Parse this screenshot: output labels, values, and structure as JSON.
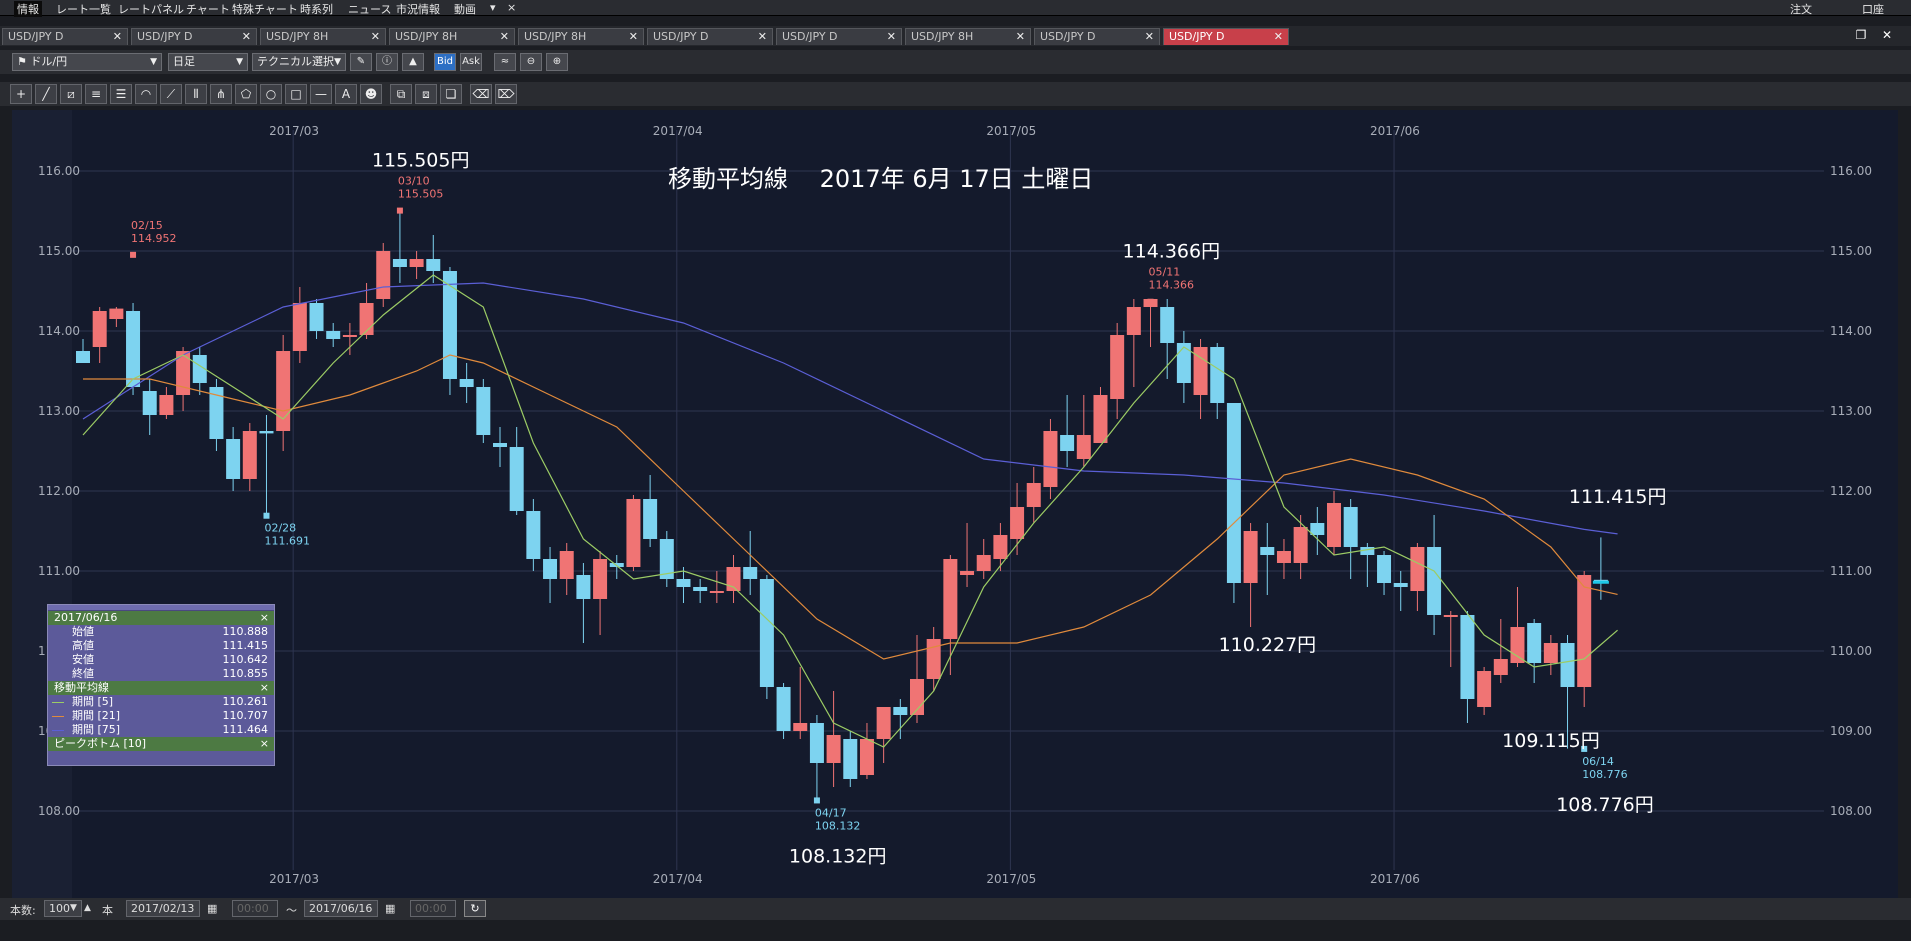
{
  "menu": {
    "items": [
      "情報",
      "レート一覧",
      "レートパネル",
      "チャート",
      "特殊チャート",
      "時系列",
      "ニュース",
      "市況情報",
      "動画"
    ],
    "dropdown_glyph": "▾",
    "close_glyph": "×",
    "right_items": [
      "注文",
      "口座"
    ]
  },
  "tabs": [
    {
      "label": "USD/JPY D",
      "active": false
    },
    {
      "label": "USD/JPY D",
      "active": false
    },
    {
      "label": "USD/JPY 8H",
      "active": false
    },
    {
      "label": "USD/JPY 8H",
      "active": false
    },
    {
      "label": "USD/JPY 8H",
      "active": false
    },
    {
      "label": "USD/JPY D",
      "active": false
    },
    {
      "label": "USD/JPY D",
      "active": false
    },
    {
      "label": "USD/JPY 8H",
      "active": false
    },
    {
      "label": "USD/JPY D",
      "active": false
    },
    {
      "label": "USD/JPY D",
      "active": true
    }
  ],
  "toolbar": {
    "pair": "ドル/円",
    "timeframe": "日足",
    "technical": "テクニカル選択",
    "bid": "Bid",
    "ask": "Ask"
  },
  "bottom": {
    "count_label": "本数:",
    "count_value": "100",
    "count_unit": "本",
    "from_date": "2017/02/13",
    "to_date": "2017/06/16",
    "from_time": "00:00",
    "to_time": "00:00",
    "tilde": "～"
  },
  "legend": {
    "date": "2017/06/16",
    "rows": [
      {
        "label": "始値",
        "value": "110.888"
      },
      {
        "label": "高値",
        "value": "111.415"
      },
      {
        "label": "安値",
        "value": "110.642"
      },
      {
        "label": "終値",
        "value": "110.855"
      }
    ],
    "ma_header": "移動平均線",
    "ma_rows": [
      {
        "label": "期間 [5]",
        "value": "110.261",
        "color": "#9ccc65"
      },
      {
        "label": "期間 [21]",
        "value": "110.707",
        "color": "#e08a3c"
      },
      {
        "label": "期間 [75]",
        "value": "111.464",
        "color": "#5b5fd6"
      }
    ],
    "peak_header": "ピークボトム [10]",
    "close_glyph": "×"
  },
  "chart_data": {
    "type": "candlestick",
    "title": "移動平均線　 2017年 6月 17日 土曜日",
    "ylim": [
      107.3,
      116.8
    ],
    "yticks": [
      "116.00",
      "115.00",
      "114.00",
      "113.00",
      "112.00",
      "111.00",
      "110.00",
      "109.00",
      "108.00"
    ],
    "ytick_values": [
      116,
      115,
      114,
      113,
      112,
      111,
      110,
      109,
      108
    ],
    "xticks": [
      {
        "label": "2017/03",
        "index": 12
      },
      {
        "label": "2017/04",
        "index": 35
      },
      {
        "label": "2017/05",
        "index": 55
      },
      {
        "label": "2017/06",
        "index": 78
      }
    ],
    "colors": {
      "up": "#f07474",
      "down": "#7dd3f0",
      "ma5": "#9ccc65",
      "ma21": "#e08a3c",
      "ma75": "#5b5fd6",
      "grid": "#2e3550",
      "axis_text": "#a8adb8"
    },
    "candles": [
      [
        113.75,
        113.6,
        113.9,
        113.6
      ],
      [
        113.8,
        114.25,
        113.6,
        114.3
      ],
      [
        114.15,
        114.28,
        114.3,
        114.05
      ],
      [
        114.25,
        113.3,
        114.35,
        113.2
      ],
      [
        113.25,
        112.95,
        113.4,
        112.7
      ],
      [
        112.95,
        113.2,
        113.3,
        112.9
      ],
      [
        113.2,
        113.75,
        113.8,
        113.0
      ],
      [
        113.7,
        113.35,
        113.8,
        113.2
      ],
      [
        113.3,
        112.65,
        113.4,
        112.5
      ],
      [
        112.65,
        112.15,
        112.8,
        112.0
      ],
      [
        112.15,
        112.75,
        112.85,
        112.0
      ],
      [
        112.75,
        112.72,
        112.95,
        111.69
      ],
      [
        112.75,
        113.75,
        113.95,
        112.5
      ],
      [
        113.75,
        114.35,
        114.55,
        113.6
      ],
      [
        114.35,
        114.0,
        114.4,
        113.9
      ],
      [
        114.0,
        113.9,
        114.1,
        113.8
      ],
      [
        113.95,
        113.95,
        114.1,
        113.7
      ],
      [
        113.95,
        114.35,
        114.6,
        113.9
      ],
      [
        114.4,
        115.0,
        115.1,
        114.3
      ],
      [
        114.9,
        114.8,
        115.5,
        114.6
      ],
      [
        114.8,
        114.9,
        115.0,
        114.65
      ],
      [
        114.9,
        114.75,
        115.2,
        114.6
      ],
      [
        114.75,
        113.4,
        114.8,
        113.2
      ],
      [
        113.4,
        113.3,
        113.6,
        113.1
      ],
      [
        113.3,
        112.7,
        113.4,
        112.6
      ],
      [
        112.6,
        112.55,
        112.8,
        112.3
      ],
      [
        112.55,
        111.75,
        112.8,
        111.7
      ],
      [
        111.75,
        111.15,
        111.9,
        111.0
      ],
      [
        111.15,
        110.9,
        111.3,
        110.6
      ],
      [
        110.9,
        111.25,
        111.35,
        110.7
      ],
      [
        110.95,
        110.65,
        111.1,
        110.1
      ],
      [
        110.65,
        111.15,
        111.25,
        110.2
      ],
      [
        111.1,
        111.05,
        111.2,
        110.9
      ],
      [
        111.05,
        111.9,
        111.95,
        111.0
      ],
      [
        111.9,
        111.4,
        112.2,
        111.3
      ],
      [
        111.4,
        110.9,
        111.5,
        110.8
      ],
      [
        110.9,
        110.8,
        111.05,
        110.6
      ],
      [
        110.8,
        110.75,
        110.9,
        110.6
      ],
      [
        110.75,
        110.75,
        111.0,
        110.6
      ],
      [
        110.75,
        111.05,
        111.2,
        110.6
      ],
      [
        111.05,
        110.9,
        111.5,
        110.7
      ],
      [
        110.9,
        109.55,
        110.95,
        109.4
      ],
      [
        109.55,
        109.0,
        109.6,
        108.9
      ],
      [
        109.0,
        109.1,
        109.8,
        108.9
      ],
      [
        109.1,
        108.6,
        109.2,
        108.13
      ],
      [
        108.6,
        108.95,
        109.5,
        108.3
      ],
      [
        108.9,
        108.4,
        109.0,
        108.3
      ],
      [
        108.45,
        108.9,
        109.1,
        108.4
      ],
      [
        108.9,
        109.3,
        109.3,
        108.6
      ],
      [
        109.3,
        109.2,
        109.4,
        108.9
      ],
      [
        109.2,
        109.65,
        110.2,
        109.1
      ],
      [
        109.65,
        110.15,
        110.3,
        109.5
      ],
      [
        110.15,
        111.15,
        111.2,
        109.7
      ],
      [
        110.95,
        111.0,
        111.6,
        110.8
      ],
      [
        111.0,
        111.2,
        111.4,
        110.9
      ],
      [
        111.15,
        111.45,
        111.6,
        111.0
      ],
      [
        111.4,
        111.8,
        112.1,
        111.2
      ],
      [
        111.8,
        112.1,
        112.3,
        111.6
      ],
      [
        112.05,
        112.75,
        112.9,
        111.9
      ],
      [
        112.7,
        112.5,
        113.2,
        112.3
      ],
      [
        112.4,
        112.7,
        113.2,
        112.3
      ],
      [
        112.6,
        113.2,
        113.3,
        112.6
      ],
      [
        113.15,
        113.95,
        114.1,
        112.9
      ],
      [
        113.95,
        114.3,
        114.4,
        113.3
      ],
      [
        114.3,
        114.4,
        114.37,
        113.8
      ],
      [
        114.3,
        113.85,
        114.4,
        113.4
      ],
      [
        113.85,
        113.35,
        114.0,
        113.1
      ],
      [
        113.2,
        113.8,
        113.9,
        112.9
      ],
      [
        113.8,
        113.1,
        113.85,
        112.9
      ],
      [
        113.1,
        110.85,
        113.1,
        110.6
      ],
      [
        110.85,
        111.5,
        111.6,
        110.3
      ],
      [
        111.3,
        111.2,
        111.6,
        110.7
      ],
      [
        111.1,
        111.25,
        111.4,
        110.9
      ],
      [
        111.1,
        111.55,
        111.7,
        110.9
      ],
      [
        111.6,
        111.45,
        111.8,
        111.2
      ],
      [
        111.3,
        111.85,
        112.0,
        111.2
      ],
      [
        111.8,
        111.3,
        111.9,
        110.9
      ],
      [
        111.3,
        111.2,
        111.35,
        110.8
      ],
      [
        111.2,
        110.85,
        111.25,
        110.7
      ],
      [
        110.85,
        110.8,
        111.0,
        110.5
      ],
      [
        110.75,
        111.3,
        111.35,
        110.5
      ],
      [
        111.3,
        110.45,
        111.7,
        110.2
      ],
      [
        110.45,
        110.45,
        110.5,
        109.8
      ],
      [
        110.45,
        109.4,
        110.5,
        109.1
      ],
      [
        109.3,
        109.75,
        109.8,
        109.2
      ],
      [
        109.7,
        109.9,
        110.4,
        109.6
      ],
      [
        109.85,
        110.3,
        110.8,
        109.8
      ],
      [
        110.35,
        109.85,
        110.4,
        109.6
      ],
      [
        109.85,
        110.1,
        110.2,
        109.7
      ],
      [
        110.1,
        109.55,
        110.2,
        108.78
      ],
      [
        109.55,
        110.95,
        111.0,
        109.3
      ],
      [
        110.89,
        110.86,
        111.42,
        110.64
      ]
    ],
    "ma5_points": [
      [
        0,
        112.7
      ],
      [
        3,
        113.4
      ],
      [
        6,
        113.7
      ],
      [
        9,
        113.3
      ],
      [
        12,
        112.9
      ],
      [
        15,
        113.6
      ],
      [
        18,
        114.2
      ],
      [
        21,
        114.7
      ],
      [
        24,
        114.3
      ],
      [
        27,
        112.6
      ],
      [
        30,
        111.4
      ],
      [
        33,
        110.9
      ],
      [
        36,
        111.0
      ],
      [
        39,
        110.8
      ],
      [
        42,
        110.2
      ],
      [
        45,
        109.1
      ],
      [
        48,
        108.8
      ],
      [
        51,
        109.5
      ],
      [
        54,
        110.8
      ],
      [
        57,
        111.6
      ],
      [
        60,
        112.3
      ],
      [
        63,
        113.1
      ],
      [
        66,
        113.8
      ],
      [
        69,
        113.4
      ],
      [
        72,
        111.8
      ],
      [
        75,
        111.2
      ],
      [
        78,
        111.3
      ],
      [
        81,
        111.0
      ],
      [
        84,
        110.2
      ],
      [
        87,
        109.8
      ],
      [
        90,
        109.9
      ],
      [
        92,
        110.26
      ]
    ],
    "ma21_points": [
      [
        0,
        113.4
      ],
      [
        4,
        113.4
      ],
      [
        8,
        113.2
      ],
      [
        12,
        113.0
      ],
      [
        16,
        113.2
      ],
      [
        20,
        113.5
      ],
      [
        22,
        113.7
      ],
      [
        24,
        113.6
      ],
      [
        28,
        113.2
      ],
      [
        32,
        112.8
      ],
      [
        36,
        112.0
      ],
      [
        40,
        111.2
      ],
      [
        44,
        110.4
      ],
      [
        48,
        109.9
      ],
      [
        52,
        110.1
      ],
      [
        56,
        110.1
      ],
      [
        60,
        110.3
      ],
      [
        64,
        110.7
      ],
      [
        68,
        111.4
      ],
      [
        72,
        112.2
      ],
      [
        76,
        112.4
      ],
      [
        80,
        112.2
      ],
      [
        84,
        111.9
      ],
      [
        88,
        111.3
      ],
      [
        90,
        110.8
      ],
      [
        92,
        110.707
      ]
    ],
    "ma75_points": [
      [
        0,
        112.9
      ],
      [
        6,
        113.7
      ],
      [
        12,
        114.3
      ],
      [
        18,
        114.55
      ],
      [
        24,
        114.6
      ],
      [
        30,
        114.4
      ],
      [
        36,
        114.1
      ],
      [
        42,
        113.6
      ],
      [
        48,
        113.0
      ],
      [
        54,
        112.4
      ],
      [
        60,
        112.25
      ],
      [
        66,
        112.2
      ],
      [
        72,
        112.1
      ],
      [
        78,
        111.95
      ],
      [
        84,
        111.75
      ],
      [
        90,
        111.52
      ],
      [
        92,
        111.464
      ]
    ],
    "peaks": [
      {
        "index": 3,
        "date": "02/15",
        "value": "114.952",
        "type": "peak",
        "big": ""
      },
      {
        "index": 11,
        "date": "02/28",
        "value": "111.691",
        "type": "bottom",
        "big": ""
      },
      {
        "index": 19,
        "date": "03/10",
        "value": "115.505",
        "type": "peak",
        "big": "115.505円"
      },
      {
        "index": 44,
        "date": "04/17",
        "value": "108.132",
        "type": "bottom",
        "big": "108.132円"
      },
      {
        "index": 64,
        "date": "05/11",
        "value": "114.366",
        "type": "peak",
        "big": "114.366円"
      },
      {
        "index": 90,
        "date": "06/14",
        "value": "108.776",
        "type": "bottom",
        "big": "108.776円"
      }
    ],
    "annotations": [
      {
        "text": "110.227円",
        "index": 70,
        "value": 110.0
      },
      {
        "text": "109.115円",
        "index": 87,
        "value": 108.8
      },
      {
        "text": "111.415円",
        "index": 91,
        "value": 111.85
      }
    ]
  }
}
